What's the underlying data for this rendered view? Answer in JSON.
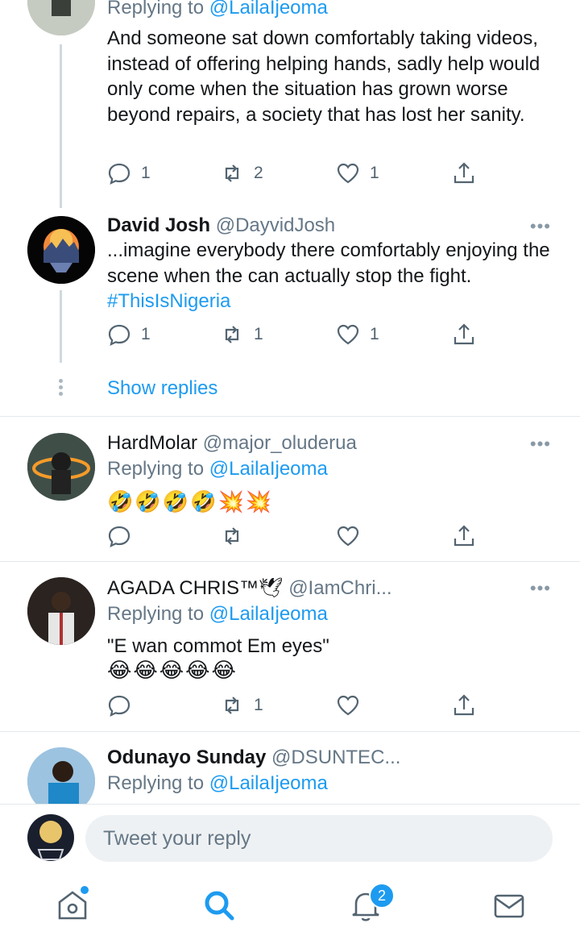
{
  "tweets": [
    {
      "replying_prefix": "Replying to",
      "replying_handle": "@LailaIjeoma",
      "text": "And someone sat down comfortably taking videos, instead of offering helping hands, sadly help would only come when the situation has grown worse beyond repairs, a society that has lost her sanity.",
      "replies": "1",
      "retweets": "2",
      "likes": "1"
    },
    {
      "name": "David Josh",
      "handle": "@DayvidJosh",
      "text": "...imagine everybody there comfortably enjoying the scene when the can actually stop the fight.",
      "hashtag": "#ThisIsNigeria",
      "replies": "1",
      "retweets": "1",
      "likes": "1"
    },
    {
      "name": "HardMolar",
      "handle": "@major_oluderua",
      "replying_prefix": "Replying to",
      "replying_handle": "@LailaIjeoma",
      "emoji_text": "🤣🤣🤣🤣💥💥",
      "replies": "",
      "retweets": "",
      "likes": ""
    },
    {
      "name": "AGADA CHRIS™🕊",
      "handle": "@IamChri...",
      "replying_prefix": "Replying to",
      "replying_handle": "@LailaIjeoma",
      "text": "\"E wan commot Em eyes\"",
      "emoji_text": "😂😂😂😂😂",
      "replies": "",
      "retweets": "1",
      "likes": ""
    },
    {
      "name": "Odunayo Sunday",
      "handle": "@DSUNTEC...",
      "replying_prefix": "Replying to",
      "replying_handle": "@LailaIjeoma"
    }
  ],
  "show_replies": "Show replies",
  "reply_placeholder": "Tweet your reply",
  "more_glyph": "•••",
  "notifications_badge": "2",
  "colors": {
    "accent": "#1d9bf0",
    "muted": "#657786",
    "divider": "#e1e8ed"
  }
}
